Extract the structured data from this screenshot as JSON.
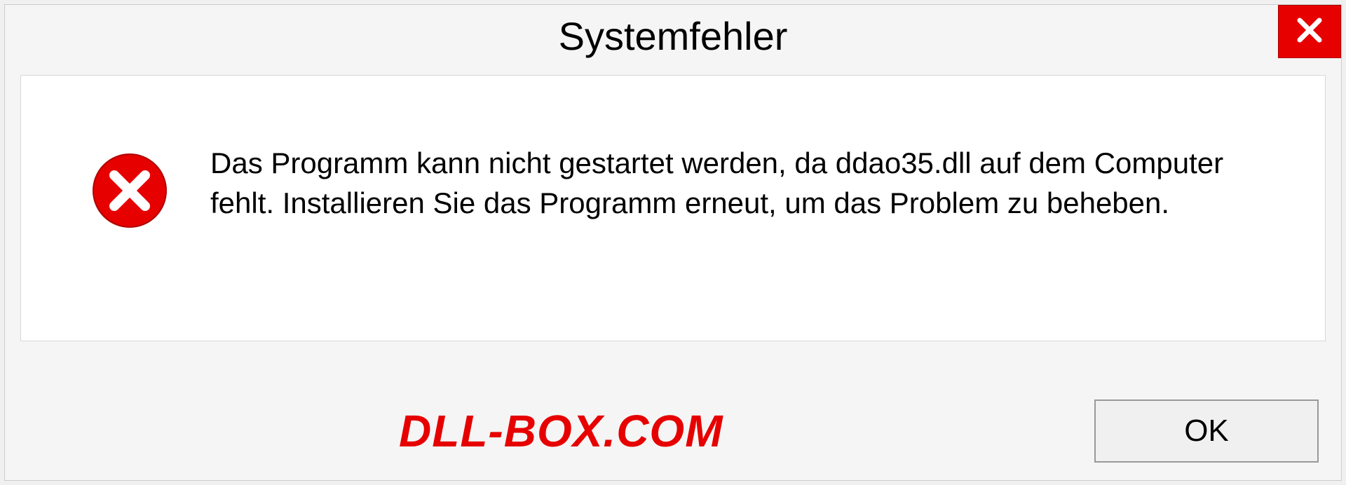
{
  "dialog": {
    "title": "Systemfehler",
    "message": "Das Programm kann nicht gestartet werden, da ddao35.dll auf dem Computer fehlt. Installieren Sie das Programm erneut, um das Problem zu beheben.",
    "ok_label": "OK"
  },
  "watermark": "DLL-BOX.COM"
}
